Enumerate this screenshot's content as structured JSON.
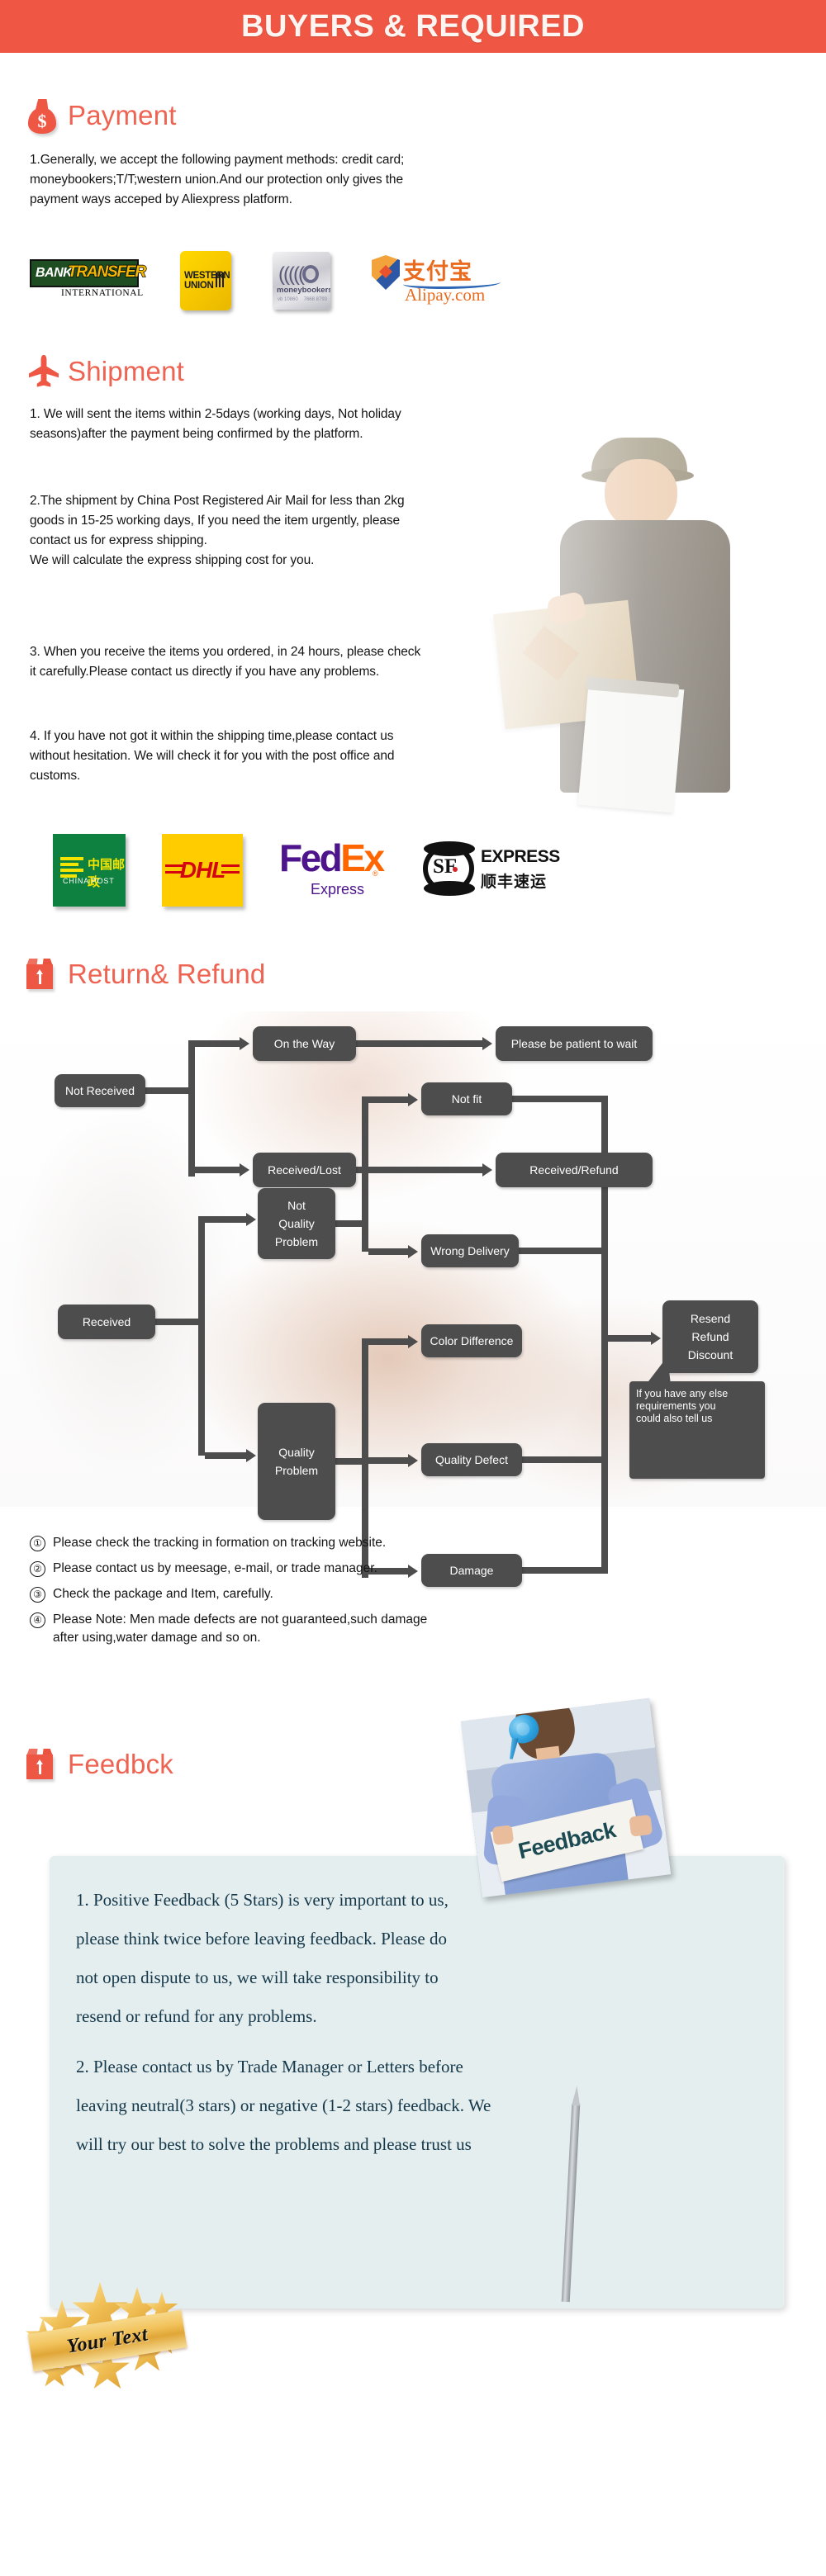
{
  "header": {
    "title": "BUYERS & REQUIRED",
    "bg_color": "#ef5744",
    "text_color": "#fdf5f2"
  },
  "accent_color": "#ee6352",
  "sections": {
    "payment": {
      "heading": "Payment",
      "icon": "money-bag-icon",
      "body": "1.Generally, we accept the following payment methods: credit card;\nmoneybookers;T/T;western union.And our protection only gives the\npayment ways acceped by Aliexpress platform.",
      "logos": [
        {
          "name": "bank-transfer",
          "line1": "BANK",
          "line2": "TRANSFER",
          "line3": "INTERNATIONAL"
        },
        {
          "name": "western-union",
          "line1": "WESTERN",
          "line2": "UNION"
        },
        {
          "name": "moneybookers",
          "line1": "moneybookers",
          "small_left": "vb 10860",
          "small_right": "7668 8793"
        },
        {
          "name": "alipay",
          "line1": "支付宝",
          "line2": "Alipay.com"
        }
      ]
    },
    "shipment": {
      "heading": "Shipment",
      "icon": "airplane-icon",
      "paragraphs": [
        "1. We will sent the items within 2-5days (working days, Not holiday\nseasons)after the payment being confirmed by the platform.",
        "2.The shipment by China Post Registered Air Mail for less than  2kg\ngoods in 15-25 working days, If  you need the item urgently, please\ncontact us for express shipping.\nWe will calculate the express shipping cost for you.",
        "3. When you receive the items you ordered, in 24 hours, please check\n it carefully.Please contact us directly if you have any problems.",
        "4. If you have not got it within the shipping time,please contact us\nwithout hesitation. We will check it for you with the post office and\ncustoms."
      ],
      "logos": [
        {
          "name": "china-post",
          "cn": "中国邮政",
          "en": "CHINA POST"
        },
        {
          "name": "dhl",
          "text": "DHL"
        },
        {
          "name": "fedex",
          "fed": "Fed",
          "ex": "Ex",
          "sub": "Express"
        },
        {
          "name": "sf-express",
          "mark": "SF",
          "en": "EXPRESS",
          "cn": "顺丰速运"
        }
      ]
    },
    "return_refund": {
      "heading": "Return& Refund",
      "icon": "box-icon",
      "flow": {
        "nodes": [
          {
            "id": "not-received",
            "label": "Not Received"
          },
          {
            "id": "on-the-way",
            "label": "On the Way"
          },
          {
            "id": "please-wait",
            "label": "Please be patient to wait"
          },
          {
            "id": "received-lost",
            "label": "Received/Lost"
          },
          {
            "id": "received-refund",
            "label": "Received/Refund"
          },
          {
            "id": "received",
            "label": "Received"
          },
          {
            "id": "not-quality-problem",
            "label": "Not\nQuality\nProblem"
          },
          {
            "id": "quality-problem",
            "label": "Quality\nProblem"
          },
          {
            "id": "not-fit",
            "label": "Not fit"
          },
          {
            "id": "wrong-delivery",
            "label": "Wrong Delivery"
          },
          {
            "id": "color-difference",
            "label": "Color Difference"
          },
          {
            "id": "quality-defect",
            "label": "Quality Defect"
          },
          {
            "id": "damage",
            "label": "Damage"
          },
          {
            "id": "resend-refund-discount",
            "label": "Resend\nRefund\nDiscount"
          }
        ],
        "callout": "If you have any else\nrequirements you\ncould also tell us"
      },
      "notes": [
        {
          "num": "①",
          "text": "Please check the tracking in formation on tracking website."
        },
        {
          "num": "②",
          "text": "Please contact us by meesage, e-mail, or trade manager."
        },
        {
          "num": "③",
          "text": "Check the package and Item, carefully."
        },
        {
          "num": "④",
          "text": "Please Note: Men made defects  are not guaranteed,such damage\nafter using,water damage and so on."
        }
      ]
    },
    "feedback": {
      "heading": "Feedbck",
      "icon": "box-icon",
      "photo_sign_text": "Feedback",
      "panel_color": "#e4eeee",
      "paragraphs": [
        "1. Positive Feedback (5 Stars) is very important to us,\nplease think twice before leaving feedback. Please do\nnot open dispute to us,   we will take responsibility to\nresend or refund for any problems.",
        "2. Please contact us by Trade Manager or Letters before\nleaving neutral(3 stars) or negative (1-2 stars) feedback. We\nwill try our best to solve the problems and please trust us"
      ]
    },
    "badge": {
      "text": "Your Text"
    }
  }
}
